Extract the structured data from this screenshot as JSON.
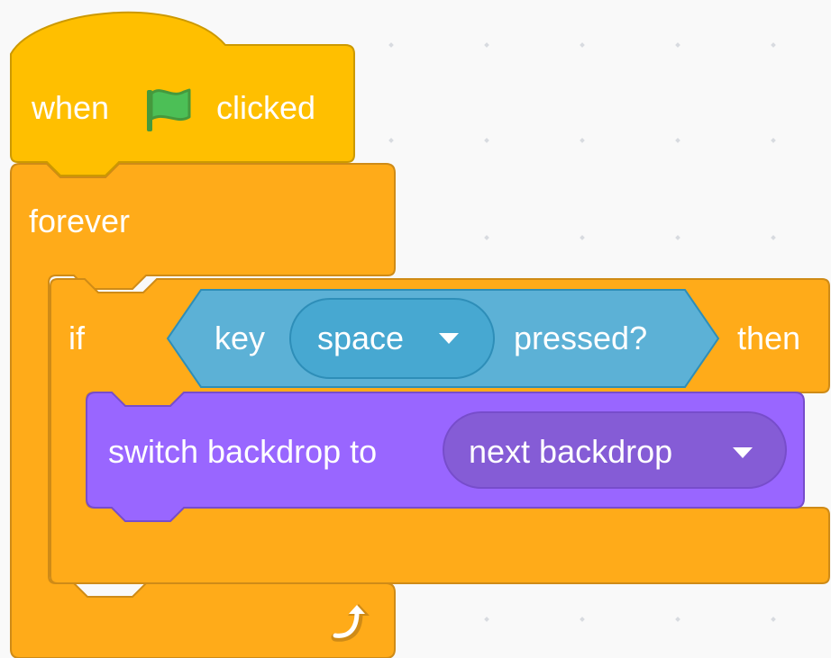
{
  "colors": {
    "background": "#f9f9f9",
    "events": "#FFBF00",
    "events_edge": "#CC9900",
    "control": "#FFAB19",
    "control_edge": "#CF8B17",
    "sensing": "#5CB1D6",
    "sensing_edge": "#2E8EB8",
    "sensing_menu": "#47A8D1",
    "looks": "#9966FF",
    "looks_edge": "#774DCB",
    "looks_menu": "#855CD6",
    "flag": "#4CBF56",
    "flag_edge": "#45993D"
  },
  "script": {
    "hat_block": {
      "word_when": "when",
      "word_clicked": "clicked",
      "icon": "green-flag-icon"
    },
    "forever_block": {
      "label": "forever",
      "loop_icon": "loop-arrow-icon"
    },
    "if_block": {
      "label_if": "if",
      "label_then": "then"
    },
    "key_pressed_block": {
      "word_key": "key",
      "key_value": "space",
      "word_pressed": "pressed?",
      "dropdown_icon": "caret-down-icon"
    },
    "switch_backdrop_block": {
      "label": "switch backdrop to",
      "backdrop_value": "next backdrop",
      "dropdown_icon": "caret-down-icon"
    }
  }
}
